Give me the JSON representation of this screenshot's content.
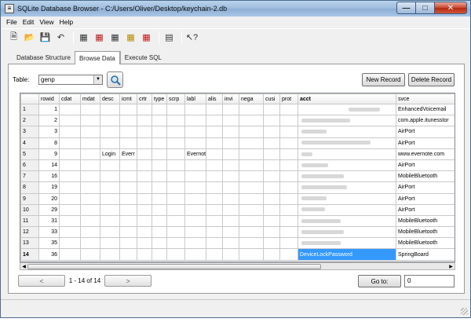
{
  "window": {
    "title": "SQLite Database Browser - C:/Users/Oliver/Desktop/keychain-2.db"
  },
  "menu": [
    "File",
    "Edit",
    "View",
    "Help"
  ],
  "toolbar_icons": [
    "new-database-icon",
    "open-database-icon",
    "save-icon",
    "undo-icon",
    "create-table-icon",
    "delete-table-icon",
    "modify-table-icon",
    "create-index-icon",
    "delete-index-icon",
    "sql-log-icon",
    "whats-this-icon"
  ],
  "tabs": [
    {
      "label": "Database Structure",
      "active": false
    },
    {
      "label": "Browse Data",
      "active": true
    },
    {
      "label": "Execute SQL",
      "active": false
    }
  ],
  "browse": {
    "table_label": "Table:",
    "table_value": "genp",
    "new_record": "New Record",
    "delete_record": "Delete Record"
  },
  "grid": {
    "columns": [
      "",
      "rowid",
      "cdat",
      "mdat",
      "desc",
      "icmt",
      "crtr",
      "type",
      "scrp",
      "labl",
      "alis",
      "invi",
      "nega",
      "cusi",
      "prot",
      "acct",
      "svce"
    ],
    "rows": [
      {
        "n": "1",
        "rowid": "1",
        "desc": "",
        "icmt": "",
        "labl": "",
        "acct_blur": 40,
        "svce": "EnhancedVoicemail"
      },
      {
        "n": "2",
        "rowid": "2",
        "desc": "",
        "icmt": "",
        "labl": "",
        "acct_blur": 62,
        "svce": "com.apple.itunesstor"
      },
      {
        "n": "3",
        "rowid": "3",
        "desc": "",
        "icmt": "",
        "labl": "",
        "acct_blur": 32,
        "svce": "AirPort"
      },
      {
        "n": "4",
        "rowid": "8",
        "desc": "",
        "icmt": "",
        "labl": "",
        "acct_blur": 88,
        "svce": "AirPort"
      },
      {
        "n": "5",
        "rowid": "9",
        "desc": "Login",
        "icmt": "Everr",
        "labl": "Evernot",
        "acct_blur": 14,
        "svce": "www.evernote.com"
      },
      {
        "n": "6",
        "rowid": "14",
        "desc": "",
        "icmt": "",
        "labl": "",
        "acct_blur": 34,
        "svce": "AirPort"
      },
      {
        "n": "7",
        "rowid": "16",
        "desc": "",
        "icmt": "",
        "labl": "",
        "acct_blur": 54,
        "svce": "MobileBluetooth"
      },
      {
        "n": "8",
        "rowid": "19",
        "desc": "",
        "icmt": "",
        "labl": "",
        "acct_blur": 58,
        "svce": "AirPort"
      },
      {
        "n": "9",
        "rowid": "20",
        "desc": "",
        "icmt": "",
        "labl": "",
        "acct_blur": 32,
        "svce": "AirPort"
      },
      {
        "n": "10",
        "rowid": "29",
        "desc": "",
        "icmt": "",
        "labl": "",
        "acct_blur": 30,
        "svce": "AirPort"
      },
      {
        "n": "11",
        "rowid": "31",
        "desc": "",
        "icmt": "",
        "labl": "",
        "acct_blur": 50,
        "svce": "MobileBluetooth"
      },
      {
        "n": "12",
        "rowid": "33",
        "desc": "",
        "icmt": "",
        "labl": "",
        "acct_blur": 54,
        "svce": "MobileBluetooth"
      },
      {
        "n": "13",
        "rowid": "35",
        "desc": "",
        "icmt": "",
        "labl": "",
        "acct_blur": 50,
        "svce": "MobileBluetooth"
      },
      {
        "n": "14",
        "rowid": "36",
        "desc": "",
        "icmt": "",
        "labl": "",
        "acct": "DeviceLockPassword",
        "svce": "SpringBoard"
      }
    ]
  },
  "pager": {
    "prev": "<",
    "count": "1 - 14 of 14",
    "next": ">",
    "goto_label": "Go to:",
    "goto_value": "0"
  }
}
